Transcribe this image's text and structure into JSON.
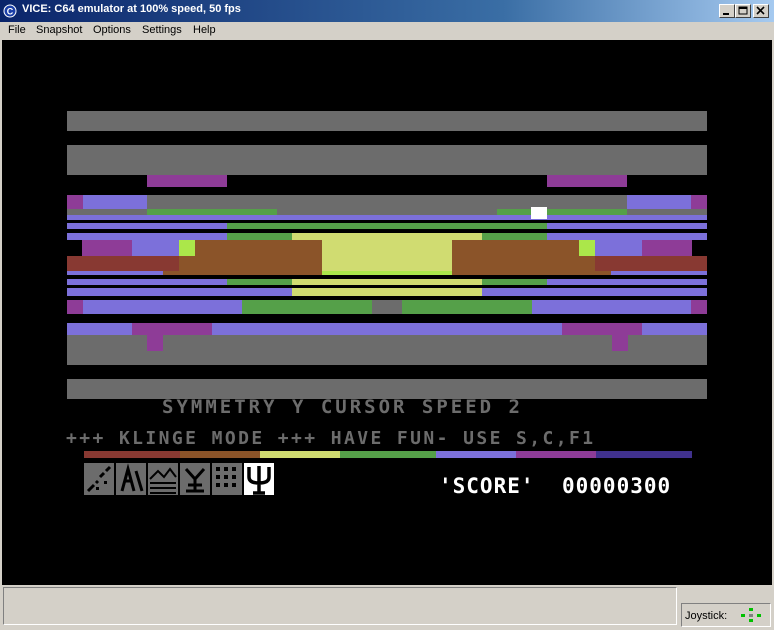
{
  "window": {
    "title": "VICE: C64 emulator at 100% speed, 50 fps"
  },
  "titlebar_buttons": [
    "minimize",
    "maximize",
    "close"
  ],
  "menu": [
    "File",
    "Snapshot",
    "Options",
    "Settings",
    "Help"
  ],
  "game": {
    "symmetry_line": "SYMMETRY Y  CURSOR SPEED 2",
    "mode_line": "+++ KLINGE MODE +++ HAVE FUN- USE S,C,F1",
    "score_label": "'SCORE'",
    "score_value": "00000300"
  },
  "status": {
    "joystick_label": "Joystick:"
  },
  "colors": {
    "titlebar_start": "#0a246a",
    "screen_bg": "#000000",
    "grey": "#6c6c6c",
    "purple": "#8e3c97",
    "light_blue": "#7c70da",
    "green": "#55a049",
    "light_green": "#abe74a",
    "yellow": "#d0dc71",
    "brown": "#8b5429",
    "red": "#883932",
    "blue": "#40318d",
    "white": "#ffffff",
    "joystick_led": "#00c000"
  }
}
